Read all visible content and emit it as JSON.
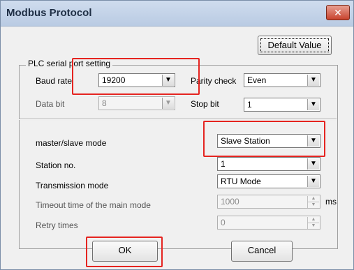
{
  "window": {
    "title": "Modbus Protocol",
    "close_glyph": "✕"
  },
  "default_value_label": "Default Value",
  "group_legend": "PLC serial port setting",
  "serial": {
    "baud_rate": {
      "label": "Baud rate",
      "value": "19200"
    },
    "parity_check": {
      "label": "Parity check",
      "value": "Even"
    },
    "data_bit": {
      "label": "Data bit",
      "value": "8"
    },
    "stop_bit": {
      "label": "Stop bit",
      "value": "1"
    }
  },
  "mode": {
    "master_slave": {
      "label": "master/slave mode",
      "value": "Slave Station"
    },
    "station_no": {
      "label": "Station no.",
      "value": "1"
    },
    "transmission": {
      "label": "Transmission mode",
      "value": "RTU Mode"
    },
    "timeout": {
      "label": "Timeout time of the main mode",
      "value": "1000",
      "unit": "ms"
    },
    "retry": {
      "label": "Retry times",
      "value": "0"
    }
  },
  "buttons": {
    "ok": "OK",
    "cancel": "Cancel"
  },
  "icons": {
    "dropdown": "chevron-down-icon",
    "spin_up": "spin-up-icon",
    "spin_down": "spin-down-icon",
    "close": "close-icon"
  },
  "colors": {
    "highlight": "#e52420",
    "titlebar": "#c4d3e8"
  }
}
